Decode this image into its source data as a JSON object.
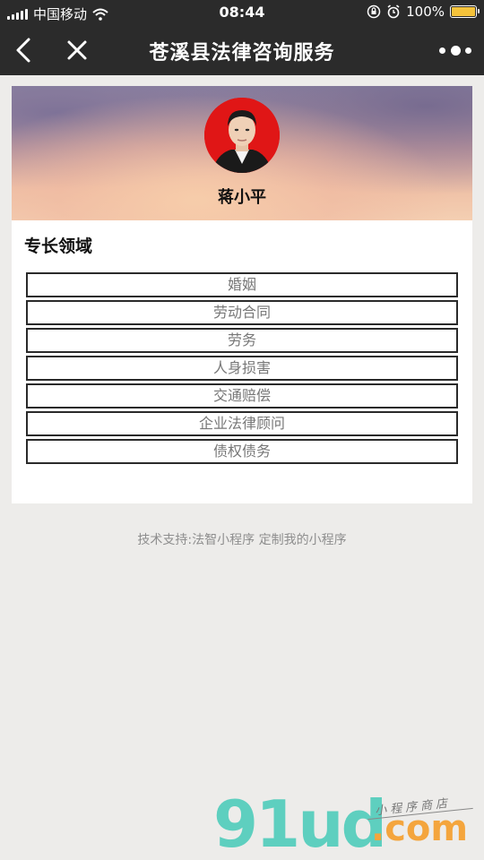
{
  "status_bar": {
    "carrier": "中国移动",
    "time": "08:44",
    "battery": "100%",
    "battery_level": 1.0
  },
  "nav": {
    "title": "苍溪县法律咨询服务"
  },
  "profile": {
    "name": "蒋小平"
  },
  "specialties": {
    "title": "专长领域",
    "items": [
      {
        "label": "婚姻"
      },
      {
        "label": "劳动合同"
      },
      {
        "label": "劳务"
      },
      {
        "label": "人身损害"
      },
      {
        "label": "交通赔偿"
      },
      {
        "label": "企业法律顾问"
      },
      {
        "label": "债权债务"
      }
    ]
  },
  "footer": {
    "text": "技术支持:法智小程序 定制我的小程序"
  },
  "watermark": {
    "logo": "91ud",
    "domain": ".com",
    "slogan": "小程序商店"
  },
  "colors": {
    "bar_bg": "#2b2b2b",
    "page_bg": "#edecea",
    "battery": "#f5c33b",
    "avatar_bg": "#e01616",
    "watermark_green": "#5ecfbf",
    "watermark_orange": "#f4a53d"
  }
}
